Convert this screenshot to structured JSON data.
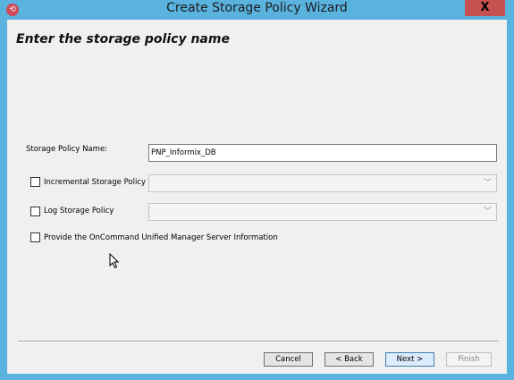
{
  "window": {
    "title": "Create Storage Policy Wizard",
    "icon": "app-icon",
    "close_label": "X"
  },
  "page": {
    "heading": "Enter the storage policy name"
  },
  "form": {
    "policy_name_label": "Storage Policy Name:",
    "policy_name_value": "PNP_Informix_DB",
    "incremental_label": "Incremental Storage Policy",
    "incremental_checked": false,
    "log_label": "Log Storage Policy",
    "log_checked": false,
    "oncommand_label": "Provide the OnCommand Unified Manager Server Information",
    "oncommand_checked": false
  },
  "buttons": {
    "cancel": "Cancel",
    "back": "< Back",
    "next": "Next >",
    "finish": "Finish"
  }
}
